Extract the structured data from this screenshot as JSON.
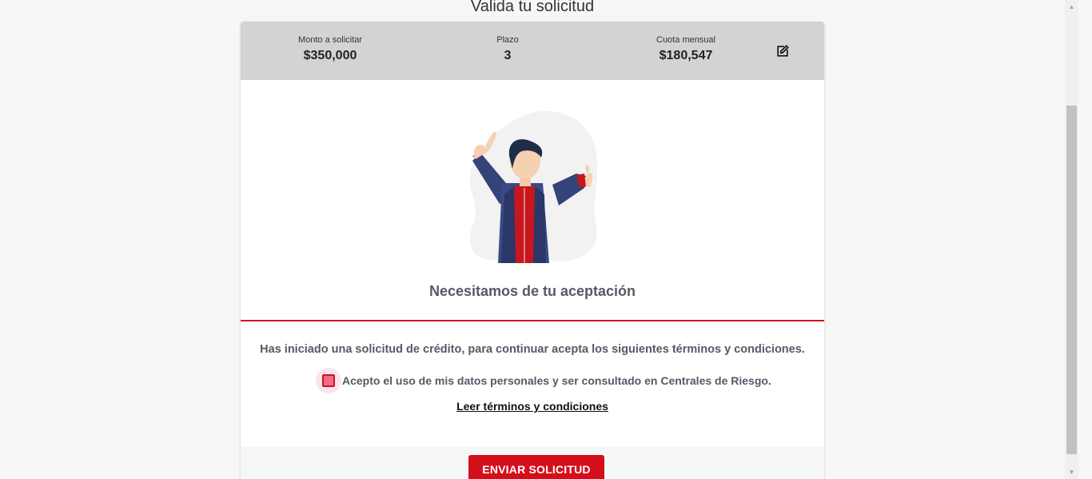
{
  "page": {
    "title": "Valida tu solicitud"
  },
  "summary": {
    "amount_label": "Monto a solicitar",
    "amount_value": "$350,000",
    "term_label": "Plazo",
    "term_value": "3",
    "fee_label": "Cuota mensual",
    "fee_value": "$180,547",
    "edit_icon": "edit-icon"
  },
  "main": {
    "illustration": "person-thumbs-up-illustration",
    "heading": "Necesitamos de tu aceptación",
    "info_text": "Has iniciado una solicitud de crédito, para continuar acepta los siguientes términos y condiciones.",
    "consent_label": "Acepto el uso de mis datos personales y ser consultado en Centrales de Riesgo.",
    "consent_checked": false,
    "terms_link": "Leer términos y condiciones"
  },
  "footer": {
    "send_button": "ENVIAR SOLICITUD"
  },
  "colors": {
    "accent": "#d50f1a",
    "summary_bg": "#d3d3d3",
    "text_muted": "#545a64"
  }
}
